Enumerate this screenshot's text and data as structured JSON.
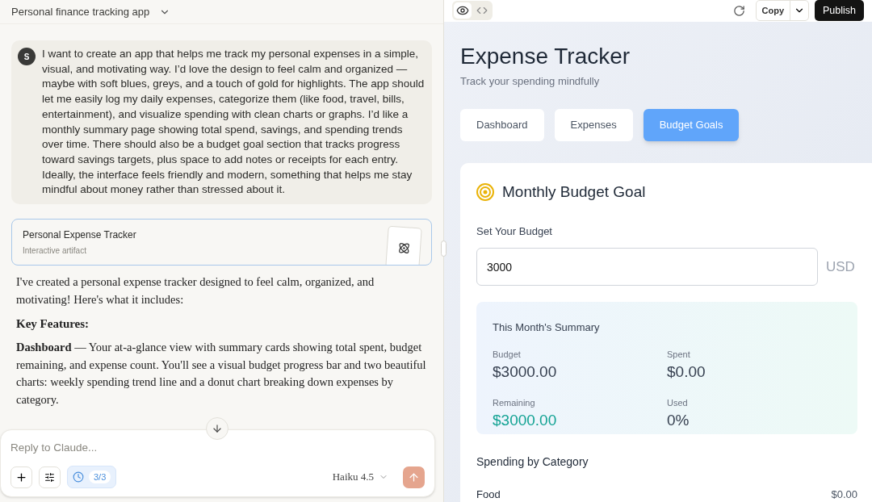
{
  "conversation": {
    "title": "Personal finance tracking app"
  },
  "user_message": {
    "avatar": "S",
    "text": "I want to create an app that helps me track my personal expenses in a simple, visual, and motivating way. I’d love the design to feel calm and organized — maybe with soft blues, greys, and a touch of gold for highlights. The app should let me easily log my daily expenses, categorize them (like food, travel, bills, entertainment), and visualize spending with clean charts or graphs. I’d like a monthly summary page showing total spend, savings, and spending trends over time. There should also be a budget goal section that tracks progress toward savings targets, plus space to add notes or receipts for each entry. Ideally, the interface feels friendly and modern, something that helps me stay mindful about money rather than stressed about it."
  },
  "artifact_card": {
    "title": "Personal Expense Tracker",
    "subtitle": "Interactive artifact"
  },
  "response": [
    {
      "kind": "paragraph",
      "text": "I've created a personal expense tracker designed to feel calm, organized, and motivating! Here's what it includes:"
    },
    {
      "kind": "heading",
      "text": "Key Features:"
    },
    {
      "kind": "paragraph",
      "text": "**Dashboard** — Your at-a-glance view with summary cards showing total spent, budget remaining, and expense count. You'll see a visual budget progress bar and two beautiful charts: weekly spending trend line and a donut chart breaking down expenses by category."
    }
  ],
  "composer": {
    "placeholder": "Reply to Claude...",
    "usage": "3/3",
    "model": "Haiku 4.5"
  },
  "preview_toolbar": {
    "views": [
      {
        "kind": "preview",
        "selected": true
      },
      {
        "kind": "code",
        "selected": false
      }
    ],
    "copy": "Copy",
    "publish": "Publish"
  },
  "app": {
    "title": "Expense Tracker",
    "subtitle": "Track your spending mindfully",
    "tabs": [
      {
        "label": "Dashboard",
        "selected": false
      },
      {
        "label": "Expenses",
        "selected": false
      },
      {
        "label": "Budget Goals",
        "selected": true
      }
    ],
    "goal_card": {
      "title": "Monthly Budget Goal",
      "budget_label": "Set Your Budget",
      "budget_value": "3000",
      "currency": "USD",
      "summary": {
        "title": "This Month's Summary",
        "stats": [
          {
            "label": "Budget",
            "value": "$3000.00",
            "kind": "neutral"
          },
          {
            "label": "Spent",
            "value": "$0.00",
            "kind": "neutral"
          },
          {
            "label": "Remaining",
            "value": "$3000.00",
            "kind": "positive"
          },
          {
            "label": "Used",
            "value": "0%",
            "kind": "neutral"
          }
        ]
      },
      "categories_title": "Spending by Category",
      "categories": [
        {
          "name": "Food",
          "amount": "$0.00"
        }
      ]
    }
  }
}
